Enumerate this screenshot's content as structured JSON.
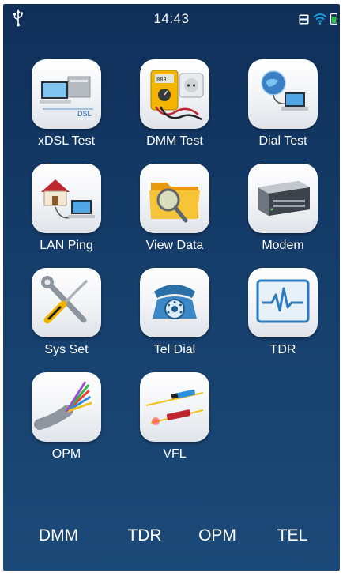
{
  "status_bar": {
    "time": "14:43",
    "icons": [
      "usb-icon",
      "sd-card-icon",
      "wifi-icon",
      "battery-icon"
    ]
  },
  "apps": [
    {
      "label": "xDSL Test",
      "icon": "xdsl-computer-icon"
    },
    {
      "label": "DMM Test",
      "icon": "multimeter-icon"
    },
    {
      "label": "Dial Test",
      "icon": "dial-globe-laptop-icon"
    },
    {
      "label": "LAN Ping",
      "icon": "house-laptop-icon"
    },
    {
      "label": "View Data",
      "icon": "folder-magnifier-icon"
    },
    {
      "label": "Modem",
      "icon": "modem-icon"
    },
    {
      "label": "Sys Set",
      "icon": "wrench-screwdriver-icon"
    },
    {
      "label": "Tel Dial",
      "icon": "rotary-telephone-icon"
    },
    {
      "label": "TDR",
      "icon": "waveform-monitor-icon"
    },
    {
      "label": "OPM",
      "icon": "fiber-optic-cable-icon"
    },
    {
      "label": "VFL",
      "icon": "fiber-laser-pen-icon"
    }
  ],
  "xdsl_badge": "DSL",
  "tabs": [
    {
      "label": "DMM"
    },
    {
      "label": "TDR"
    },
    {
      "label": "OPM"
    },
    {
      "label": "TEL"
    }
  ],
  "colors": {
    "background_top": "#0f2f59",
    "background_bottom": "#1c4a78",
    "text": "#ffffff",
    "wifi": "#1aa7e0",
    "battery": "#29c54a"
  }
}
